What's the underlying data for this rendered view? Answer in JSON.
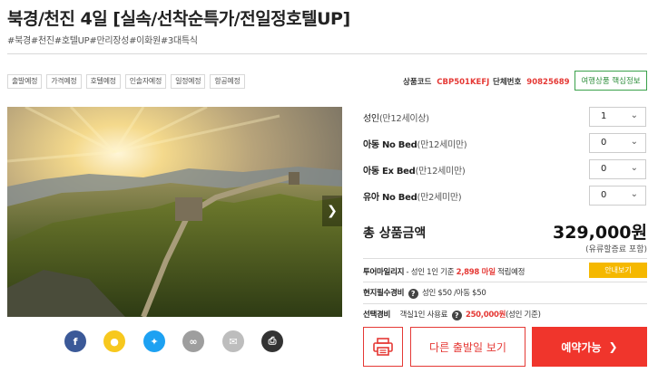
{
  "product": {
    "title": "북경/천진 4일 [실속/선착순특가/전일정호텔UP]",
    "hashtags": "#북경#천진#호텔UP#만리장성#이화원#3대특식"
  },
  "tags": [
    "출발예정",
    "가격예정",
    "호텔예정",
    "인솔자예정",
    "일정예정",
    "항공예정"
  ],
  "codes": {
    "product_code_label": "상품코드",
    "product_code": "CBP501KEFJ",
    "group_no_label": "단체번호",
    "group_no": "90825689"
  },
  "core_info_button": "여행상품 핵심정보",
  "persons": [
    {
      "name": "성인",
      "note": "(만12세이상)",
      "qty": "1"
    },
    {
      "name": "아동 No Bed",
      "note": "(만12세미만)",
      "qty": "0"
    },
    {
      "name": "아동 Ex Bed",
      "note": "(만12세미만)",
      "qty": "0"
    },
    {
      "name": "유아 No Bed",
      "note": "(만2세미만)",
      "qty": "0"
    }
  ],
  "total": {
    "label": "총 상품금액",
    "price": "329,000원",
    "note": "(유류할증료 포함)"
  },
  "mileage": {
    "label": "투어마일리지",
    "text_before": "- 성인 1인 기준",
    "amount": "2,898 마일",
    "text_after": "적립예정",
    "button": "안내보기"
  },
  "local_fee": {
    "label": "현지필수경비",
    "text": "성인 $50 /아동 $50"
  },
  "optional": {
    "label": "선택경비",
    "text_before": "객실1인 사용료",
    "amount": "250,000원",
    "text_after": "(성인 기준)"
  },
  "buttons": {
    "other_dates": "다른 출발일 보기",
    "reserve": "예약가능"
  },
  "share_icons": [
    "facebook-icon",
    "kakaostory-icon",
    "twitter-icon",
    "link-icon",
    "email-icon",
    "print-icon"
  ],
  "colors": {
    "accent_red": "#f0352c",
    "green": "#3aa14a",
    "yellow": "#f5b800"
  }
}
